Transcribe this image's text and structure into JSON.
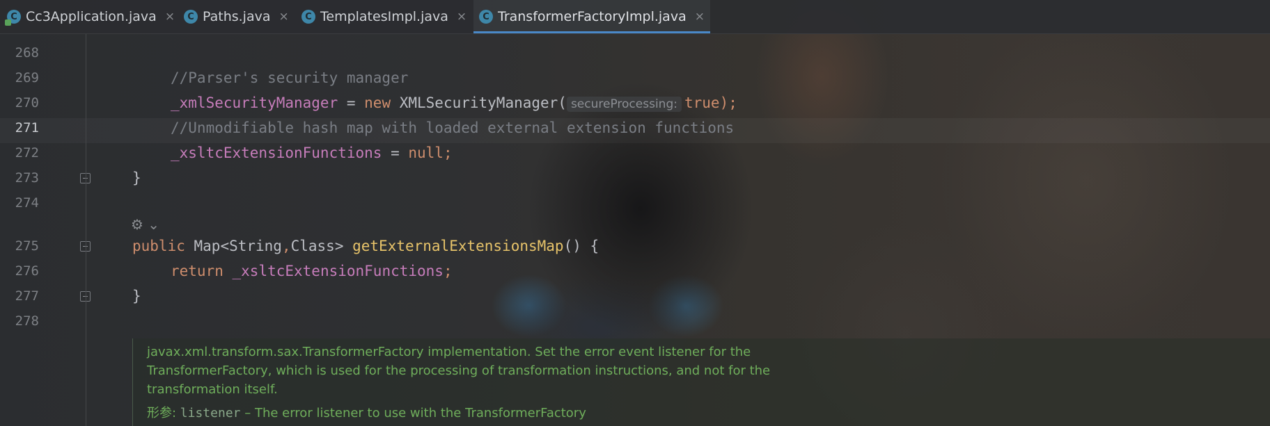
{
  "tabs": [
    {
      "label": "Cc3Application.java",
      "icon": "class-run-icon",
      "active": false
    },
    {
      "label": "Paths.java",
      "icon": "class-icon",
      "active": false
    },
    {
      "label": "TemplatesImpl.java",
      "icon": "class-icon",
      "active": false
    },
    {
      "label": "TransformerFactoryImpl.java",
      "icon": "class-icon",
      "active": true
    }
  ],
  "tab_close_glyph": "×",
  "line_numbers": [
    "268",
    "269",
    "270",
    "271",
    "272",
    "273",
    "274",
    "275",
    "276",
    "277",
    "278"
  ],
  "current_line": "271",
  "code": {
    "l269_comment": "//Parser's security manager",
    "l270_field": "_xmlSecurityManager",
    "l270_eq": " = ",
    "l270_new": "new ",
    "l270_call": "XMLSecurityManager(",
    "l270_hint": "secureProcessing:",
    "l270_true": "true",
    "l270_end": ");",
    "l271_comment": "//Unmodifiable hash map with loaded external extension functions",
    "l272_field": "_xsltcExtensionFunctions",
    "l272_eq": " = ",
    "l272_null": "null",
    "l272_end": ";",
    "l273_brace": "}",
    "l275_public": "public ",
    "l275_type1": "Map<String",
    "l275_comma": ",",
    "l275_type2": "Class> ",
    "l275_method": "getExternalExtensionsMap",
    "l275_rest": "() {",
    "l276_return": "return ",
    "l276_field": "_xsltcExtensionFunctions",
    "l276_end": ";",
    "l277_brace": "}"
  },
  "gear_glyph": "⚙ ⌄",
  "doc": {
    "line1": "javax.xml.transform.sax.TransformerFactory implementation. Set the error event listener for the",
    "line2": "TransformerFactory, which is used for the processing of transformation instructions, and not for the",
    "line3": "transformation itself.",
    "param_label": "形参: ",
    "param_name": "listener",
    "param_desc": " – The error listener to use with the TransformerFactory"
  },
  "colors": {
    "keyword": "#cf8e6d",
    "field": "#c77dbb",
    "comment": "#7a7e85",
    "method": "#e8c46a",
    "doc": "#6fae5b",
    "accent": "#4a88c7"
  }
}
